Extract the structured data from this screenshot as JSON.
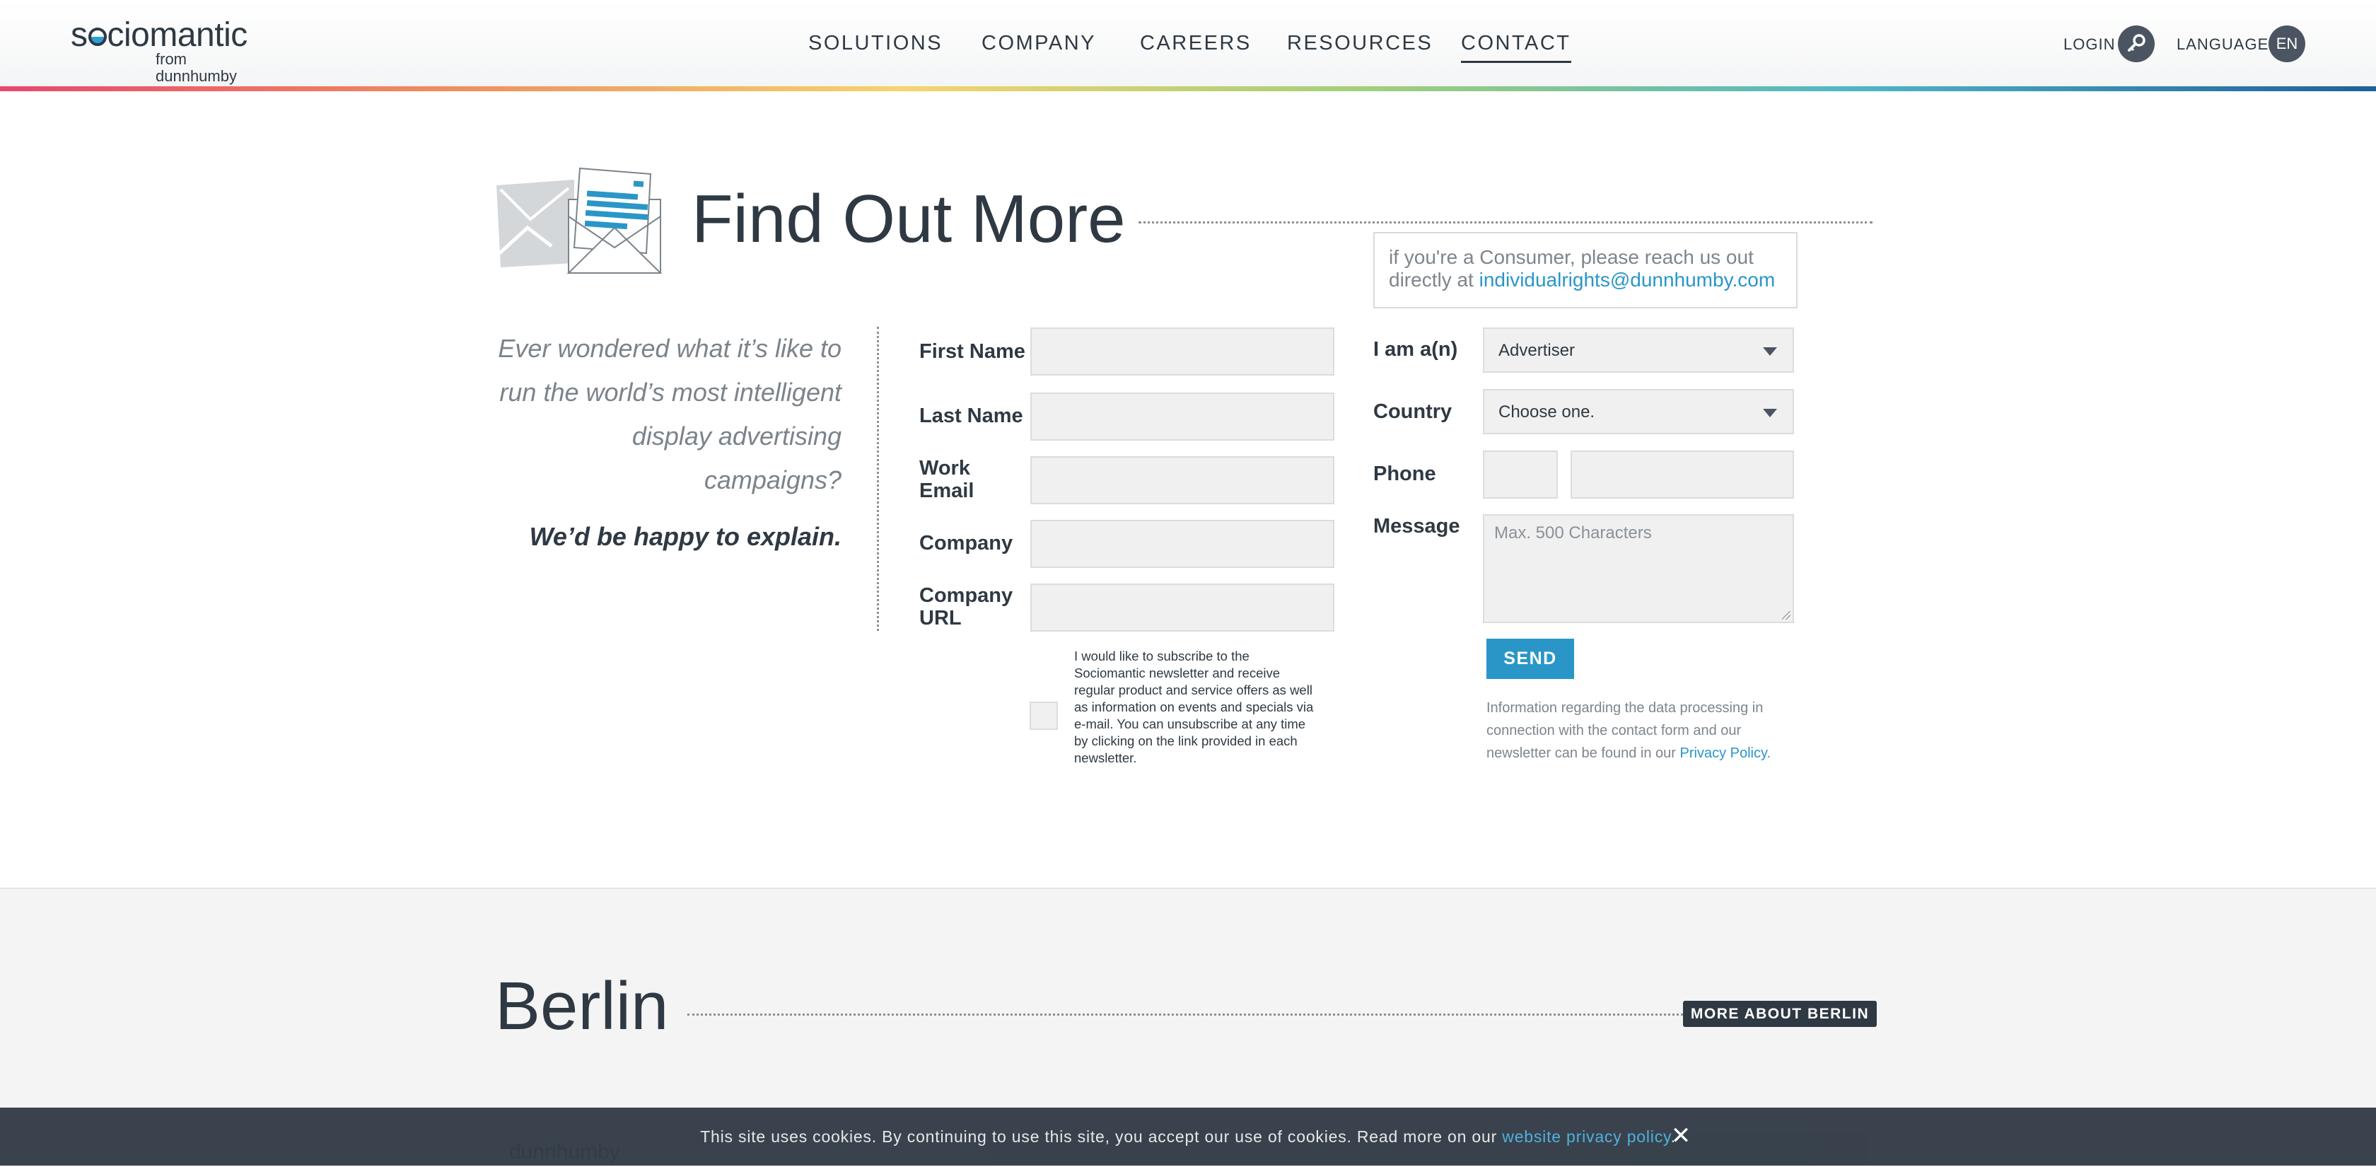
{
  "header": {
    "logo_text_before": "s",
    "logo_text_after": "ciomantic",
    "logo_sub": "from dunnhumby",
    "nav": [
      {
        "label": "SOLUTIONS"
      },
      {
        "label": "COMPANY"
      },
      {
        "label": "CAREERS"
      },
      {
        "label": "RESOURCES"
      },
      {
        "label": "CONTACT",
        "active": true
      }
    ],
    "login_label": "LOGIN",
    "language_label": "LANGUAGE",
    "language_code": "EN"
  },
  "main": {
    "title": "Find Out More",
    "consumer_note": "if you're a Consumer, please reach us out directly at",
    "consumer_email": "individualrights@dunnhumby.com",
    "intro_question": "Ever wondered what it’s like to run the world’s most intelligent display advertising campaigns?",
    "intro_answer": "We’d be happy to explain."
  },
  "form": {
    "first_name_label": "First Name",
    "last_name_label": "Last Name",
    "work_email_label": "Work Email",
    "company_label": "Company",
    "company_url_label": "Company URL",
    "role_label": "I am a(n)",
    "role_value": "Advertiser",
    "country_label": "Country",
    "country_value": "Choose one.",
    "phone_label": "Phone",
    "message_label": "Message",
    "message_placeholder": "Max. 500 Characters",
    "newsletter_text": "I would like to subscribe to the Sociomantic newsletter and receive regular product and service offers as well as information on events and specials via e-mail. You can unsubscribe at any time by clicking on the link provided in each newsletter.",
    "send_label": "SEND",
    "privacy_text": "Information regarding the data processing in connection with the contact form and our newsletter can be found in our",
    "privacy_link": "Privacy Policy",
    "privacy_end": "."
  },
  "berlin": {
    "title": "Berlin",
    "more_button": "MORE ABOUT BERLIN",
    "office_name": "dunnhumby"
  },
  "cookie": {
    "text": "This site uses cookies. By continuing to use this site, you accept our use of cookies. Read more on our",
    "link": "website privacy policy",
    "end": ".",
    "close_glyph": "✕"
  },
  "colors": {
    "accent": "#2a96c8",
    "dark": "#2f3943",
    "input_bg": "#f0f0f0"
  }
}
